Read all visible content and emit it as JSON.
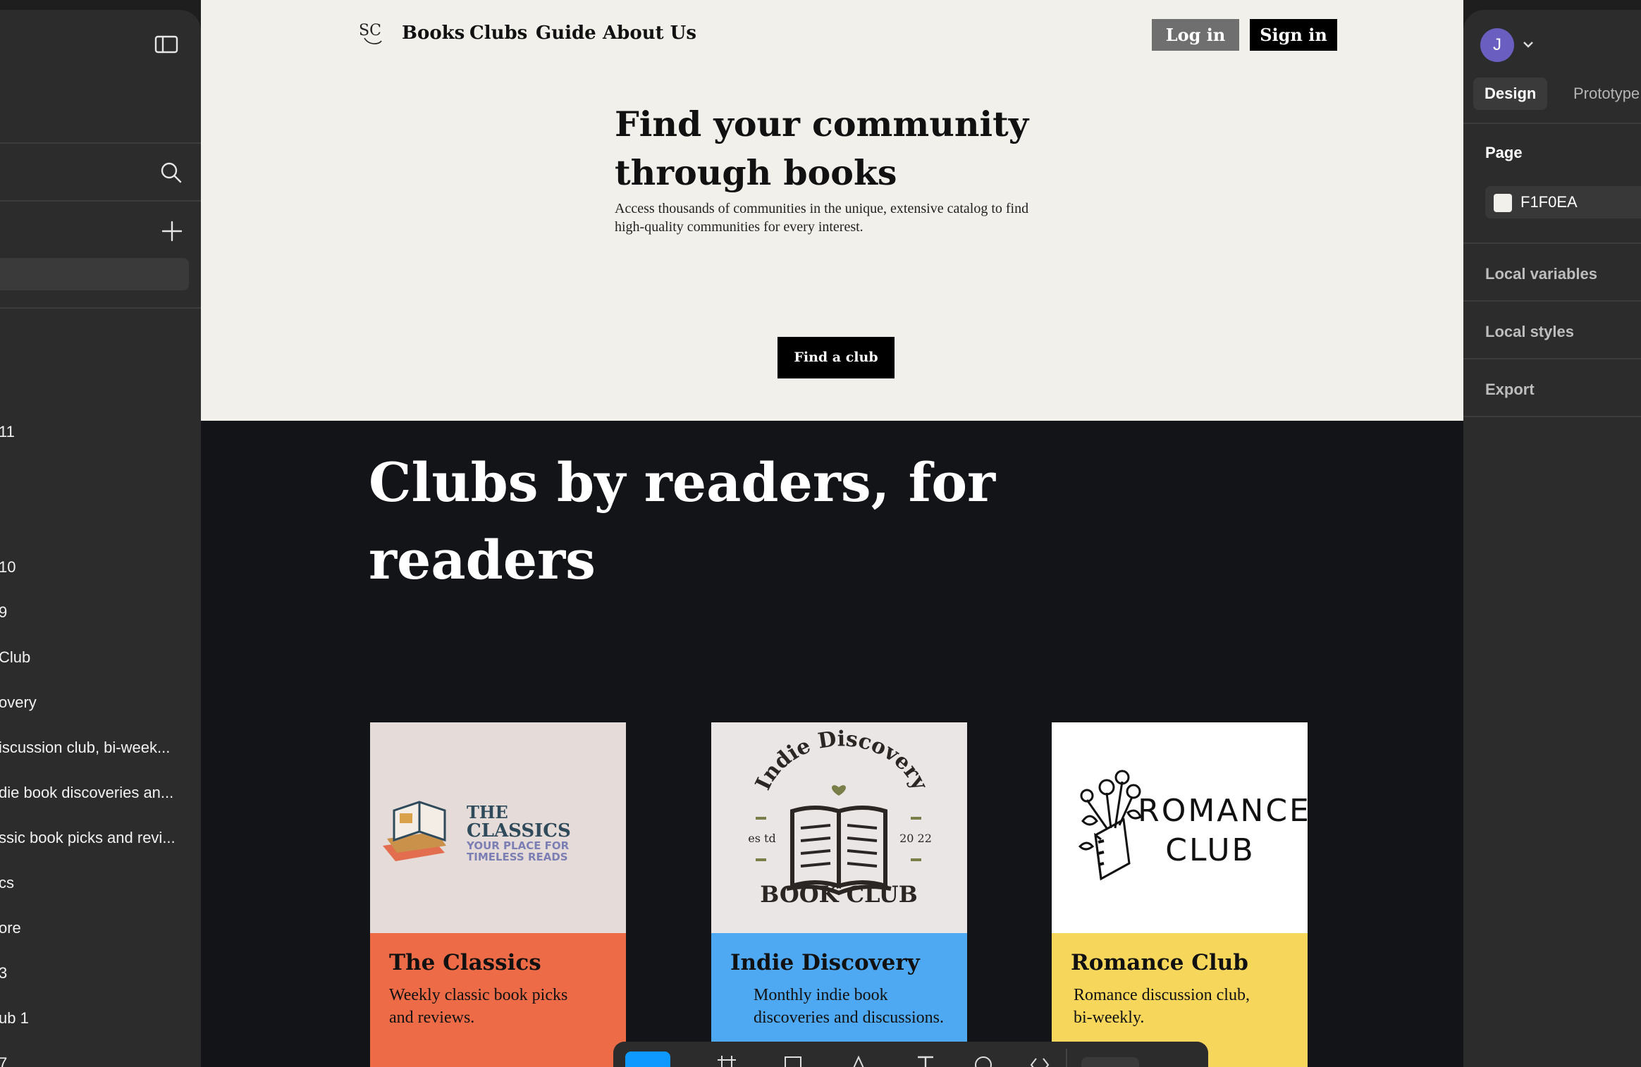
{
  "left_panel": {
    "layers": [
      "11",
      "10",
      "9",
      "Club",
      "overy",
      "iscussion club, bi-week...",
      "die book discoveries an...",
      "ssic book picks and revi...",
      "cs",
      "ore",
      "3",
      "ub 1",
      "7"
    ]
  },
  "site": {
    "nav": {
      "logo": "SC",
      "links": [
        "Books",
        "Clubs",
        "Guide",
        "About Us"
      ],
      "login": "Log in",
      "signin": "Sign in"
    },
    "hero": {
      "title": "Find your community through books",
      "subtitle": "Access thousands of communities in the unique, extensive catalog to find high-quality communities for every interest.",
      "cta": "Find a club",
      "bg_color": "#F1F0EA"
    },
    "section_title": "Clubs by readers, for readers",
    "cards": [
      {
        "title": "The Classics",
        "description": "Weekly classic book picks and reviews.",
        "color": "#ED6B47",
        "image_color": "#E5DBD8",
        "logo_line1": "THE",
        "logo_line2": "CLASSICS",
        "logo_tag1": "YOUR PLACE FOR",
        "logo_tag2": "TIMELESS READS"
      },
      {
        "title": "Indie Discovery",
        "description": "Monthly indie book discoveries and discussions.",
        "color": "#4EA8F2",
        "image_color": "#EAE6E6",
        "logo_arc": "Indie Discovery",
        "logo_bottom": "BOOK CLUB",
        "logo_left": "es td",
        "logo_right": "20 22"
      },
      {
        "title": "Romance Club",
        "description": "Romance discussion club, bi-weekly.",
        "color": "#F7D65C",
        "image_color": "#FFFFFF",
        "logo_line1": "ROMANCE",
        "logo_line2": "CLUB"
      }
    ]
  },
  "right_panel": {
    "avatar_initial": "J",
    "tabs": [
      "Design",
      "Prototype"
    ],
    "page_label": "Page",
    "page_color": "F1F0EA",
    "sections": [
      "Local variables",
      "Local styles",
      "Export"
    ]
  },
  "icons": [
    "sidebar-toggle-icon",
    "search-icon",
    "plus-icon",
    "chevron-down-icon",
    "move-tool-icon",
    "frame-tool-icon",
    "shape-tool-icon",
    "pen-tool-icon",
    "text-tool-icon",
    "comment-tool-icon",
    "code-tool-icon"
  ]
}
